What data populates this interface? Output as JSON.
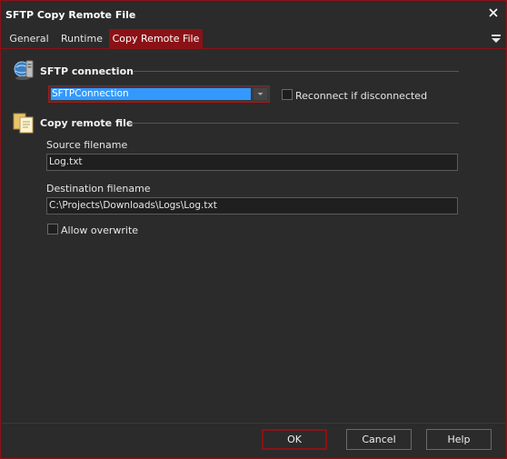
{
  "window": {
    "title": "SFTP Copy Remote File",
    "close_icon": "close-icon",
    "border_color": "#8a1216"
  },
  "tabs": [
    {
      "label": "General",
      "active": false
    },
    {
      "label": "Runtime",
      "active": false
    },
    {
      "label": "Copy Remote File",
      "active": true
    }
  ],
  "tab_menu_icon": "dropdown-menu-icon",
  "sftp_section": {
    "title": "SFTP connection",
    "icon": "sftp-connection-icon",
    "connection_value": "SFTPConnection",
    "reconnect_label": "Reconnect if disconnected",
    "reconnect_checked": false
  },
  "copy_section": {
    "title": "Copy remote file",
    "icon": "copy-file-icon",
    "source_label": "Source filename",
    "source_value": "Log.txt",
    "destination_label": "Destination filename",
    "destination_value": "C:\\Projects\\Downloads\\Logs\\Log.txt",
    "overwrite_label": "Allow overwrite",
    "overwrite_checked": false
  },
  "buttons": {
    "ok": "OK",
    "cancel": "Cancel",
    "help": "Help"
  },
  "colors": {
    "accent": "#8a1216",
    "selection": "#3399ff",
    "background": "#2b2b2b"
  }
}
